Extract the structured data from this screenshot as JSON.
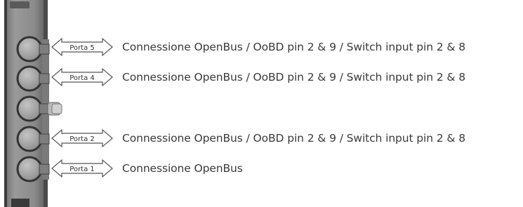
{
  "ports": [
    {
      "arrow_label": "Porta 5",
      "description": "Connessione OpenBus / OoBD pin 2 & 9 / Switch input pin 2 & 8"
    },
    {
      "arrow_label": "Porta 4",
      "description": "Connessione OpenBus / OoBD pin 2 & 9 / Switch input pin 2 & 8"
    },
    {
      "arrow_label": "Porta 2",
      "description": "Connessione OpenBus / OoBD pin 2 & 9 / Switch input pin 2 & 8"
    },
    {
      "arrow_label": "Porta 1",
      "description": "Connessione OpenBus"
    }
  ],
  "colors": {
    "device_body": "#8e8e8e",
    "device_dark": "#2a2a2a",
    "port_ring": "#3a3a3a",
    "port_fill": "#a6a6a6",
    "arrow_stroke": "#555555",
    "text": "#3a3a3a"
  }
}
